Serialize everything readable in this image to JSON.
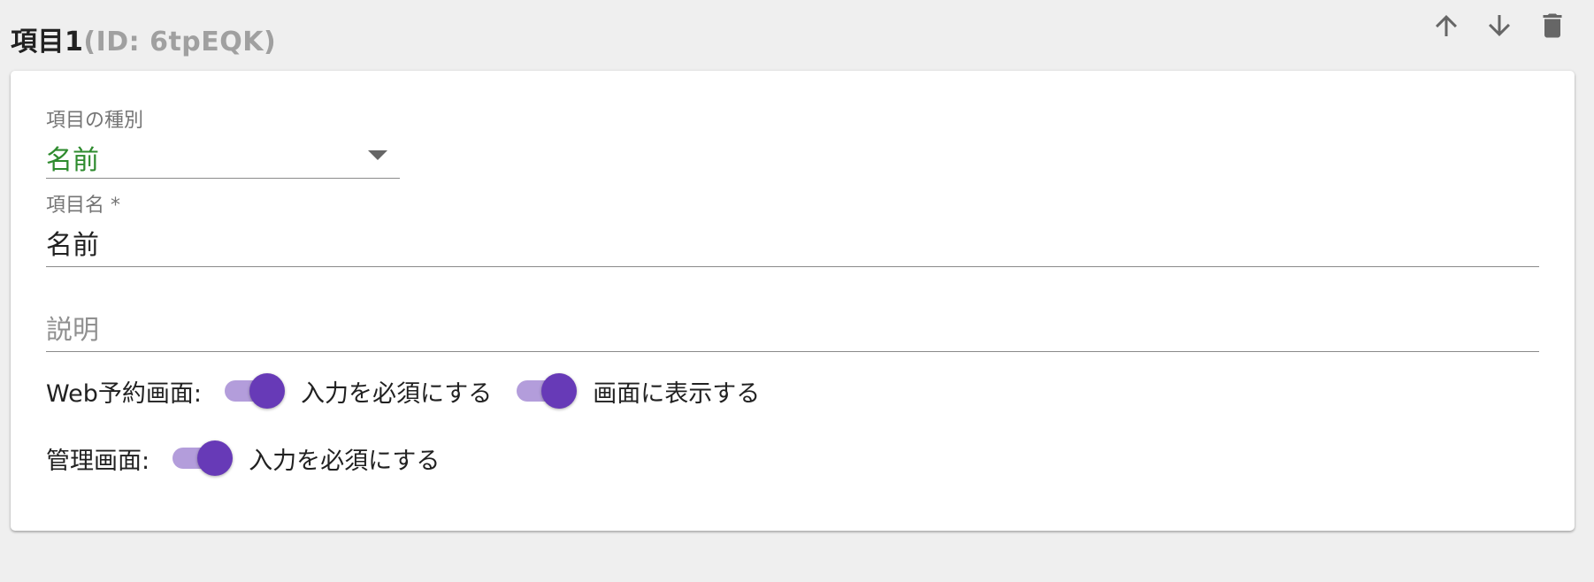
{
  "header": {
    "title": "項目1",
    "id_text": "(ID: 6tpEQK)"
  },
  "actions": {
    "up_icon": "arrow-up-icon",
    "down_icon": "arrow-down-icon",
    "delete_icon": "trash-icon"
  },
  "type_field": {
    "label": "項目の種別",
    "value": "名前"
  },
  "name_field": {
    "label": "項目名 *",
    "value": "名前"
  },
  "description_field": {
    "placeholder": "説明"
  },
  "web_row": {
    "label": "Web予約画面:",
    "required_label": "入力を必須にする",
    "required_on": true,
    "display_label": "画面に表示する",
    "display_on": true
  },
  "admin_row": {
    "label": "管理画面:",
    "required_label": "入力を必須にする",
    "required_on": true
  },
  "colors": {
    "accent": "#673ab7",
    "accent_track": "#b39ddb",
    "select_value": "#2e8b2e"
  }
}
